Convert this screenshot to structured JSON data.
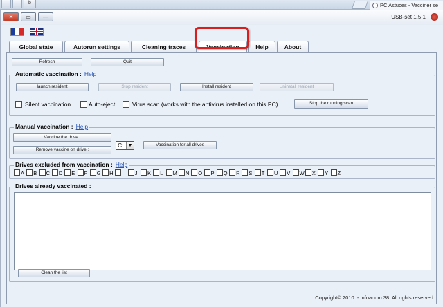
{
  "browser": {
    "tab_title": "PC Astuces - Vacciner se",
    "strip_buttons": [
      "",
      "",
      "b"
    ]
  },
  "window": {
    "title": "USB-set 1.5.1",
    "close_glyph": "✕",
    "max_glyph": "▭",
    "min_glyph": "—"
  },
  "tabs": [
    "Global state",
    "Autorun settings",
    "Cleaning traces",
    "Vaccination",
    "Help",
    "About"
  ],
  "toolbar": {
    "refresh": "Refresh",
    "quit": "Quit"
  },
  "auto_vaccination": {
    "title": "Automatic vaccination :",
    "help": "Help",
    "launch_resident": "launch resident",
    "stop_resident": "Stop resident",
    "install_resident": "Install resident",
    "uninstall_resident": "Uninstall resident",
    "silent_vaccination": "Silent vaccination",
    "auto_eject": "Auto-eject",
    "virus_scan": "Virus scan (works with the antivirus installed on this PC)",
    "stop_scan": "Stop the running scan"
  },
  "manual_vaccination": {
    "title": "Manual vaccination :",
    "help": "Help",
    "vaccine_drive": "Vaccine the drive :",
    "remove_vaccine": "Remove vaccine on drive :",
    "drive_value": "C:",
    "all_drives": "Vaccination for all drives"
  },
  "excluded": {
    "title": "Drives excluded from vaccination :",
    "help": "Help",
    "drives": [
      "A",
      "B",
      "C",
      "D",
      "E",
      "F",
      "G",
      "H",
      "I",
      "J",
      "K",
      "L",
      "M",
      "N",
      "O",
      "P",
      "Q",
      "R",
      "S",
      "T",
      "U",
      "V",
      "W",
      "X",
      "Y",
      "Z"
    ]
  },
  "vaccinated": {
    "title": "Drives already vaccinated :",
    "clean": "Clean the list"
  },
  "footer": {
    "copyright": "Copyright© 2010. - Infoadom 38. All rights reserved."
  }
}
